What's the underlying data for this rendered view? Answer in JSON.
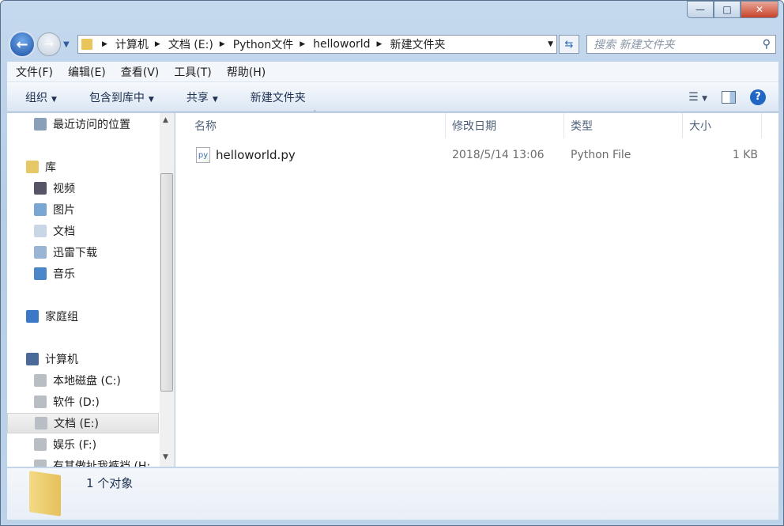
{
  "window": {
    "minimize": "—",
    "maximize": "□",
    "close": "✕"
  },
  "address": {
    "crumbs": [
      "计算机",
      "文档 (E:)",
      "Python文件",
      "helloworld",
      "新建文件夹"
    ]
  },
  "search": {
    "placeholder": "搜索 新建文件夹"
  },
  "menu": [
    "文件(F)",
    "编辑(E)",
    "查看(V)",
    "工具(T)",
    "帮助(H)"
  ],
  "toolbar": {
    "organize": "组织",
    "include": "包含到库中",
    "share": "共享",
    "new_folder": "新建文件夹",
    "help": "?"
  },
  "sidebar": {
    "items": [
      {
        "label": "最近访问的位置",
        "indent": true,
        "icon": "recent-places-icon"
      },
      {
        "label": "库",
        "indent": false,
        "icon": "library-icon"
      },
      {
        "label": "视频",
        "indent": true,
        "icon": "video-icon"
      },
      {
        "label": "图片",
        "indent": true,
        "icon": "pictures-icon"
      },
      {
        "label": "文档",
        "indent": true,
        "icon": "documents-icon"
      },
      {
        "label": "迅雷下载",
        "indent": true,
        "icon": "download-icon"
      },
      {
        "label": "音乐",
        "indent": true,
        "icon": "music-icon"
      },
      {
        "label": "家庭组",
        "indent": false,
        "icon": "homegroup-icon"
      },
      {
        "label": "计算机",
        "indent": false,
        "icon": "computer-icon"
      },
      {
        "label": "本地磁盘 (C:)",
        "indent": true,
        "icon": "drive-icon"
      },
      {
        "label": "软件 (D:)",
        "indent": true,
        "icon": "drive-icon"
      },
      {
        "label": "文档 (E:)",
        "indent": true,
        "icon": "drive-icon",
        "selected": true
      },
      {
        "label": "娱乐 (F:)",
        "indent": true,
        "icon": "drive-icon"
      },
      {
        "label": "有其傲扯我裤裆 (H:",
        "indent": true,
        "icon": "drive-icon"
      }
    ]
  },
  "columns": [
    "名称",
    "修改日期",
    "类型",
    "大小"
  ],
  "files": [
    {
      "name": "helloworld.py",
      "modified": "2018/5/14 13:06",
      "type": "Python File",
      "size": "1 KB"
    }
  ],
  "status": {
    "count": "1 个对象"
  }
}
